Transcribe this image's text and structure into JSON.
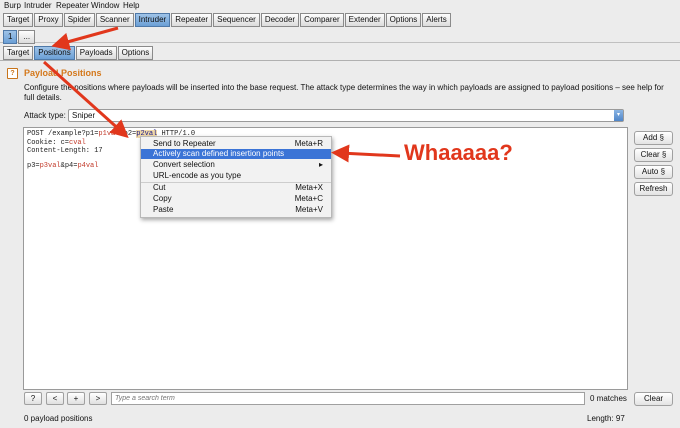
{
  "menubar": [
    "Burp",
    "Intruder",
    "Repeater",
    "Window",
    "Help"
  ],
  "main_tabs": [
    "Target",
    "Proxy",
    "Spider",
    "Scanner",
    "Intruder",
    "Repeater",
    "Sequencer",
    "Decoder",
    "Comparer",
    "Extender",
    "Options",
    "Alerts"
  ],
  "main_tabs_active": "Intruder",
  "number_tabs": [
    "1",
    "..."
  ],
  "sub_tabs": [
    "Target",
    "Positions",
    "Payloads",
    "Options"
  ],
  "sub_tabs_active": "Positions",
  "section": {
    "title": "Payload Positions",
    "description": "Configure the positions where payloads will be inserted into the base request. The attack type determines the way in which payloads are assigned to payload positions – see help for full details.",
    "help_icon": "?"
  },
  "attack_type": {
    "label": "Attack type:",
    "value": "Sniper"
  },
  "request_lines": [
    [
      {
        "t": "POST /example?p1=",
        "c": "plain"
      },
      {
        "t": "p1val",
        "c": "pl"
      },
      {
        "t": "&p2=",
        "c": "plain"
      },
      {
        "t": "p2val",
        "c": "mk"
      },
      {
        "t": " HTTP/1.0",
        "c": "plain"
      }
    ],
    [
      {
        "t": "Cookie: c=",
        "c": "plain"
      },
      {
        "t": "cval",
        "c": "pl"
      }
    ],
    [
      {
        "t": "Content-Length: 17",
        "c": "plain"
      }
    ],
    [],
    [
      {
        "t": "p3=",
        "c": "plain"
      },
      {
        "t": "p3val",
        "c": "pl"
      },
      {
        "t": "&p4=",
        "c": "plain"
      },
      {
        "t": "p4val",
        "c": "pl"
      }
    ]
  ],
  "side_buttons": [
    "Add §",
    "Clear §",
    "Auto §",
    "Refresh"
  ],
  "context_menu": {
    "items": [
      {
        "label": "Send to Repeater",
        "shortcut": "Meta+R"
      },
      {
        "label": "Actively scan defined insertion points",
        "shortcut": "",
        "highlighted": true
      },
      {
        "label": "Convert selection",
        "shortcut": "▸"
      },
      {
        "label": "URL-encode as you type",
        "shortcut": ""
      },
      {
        "label": "Cut",
        "shortcut": "Meta+X"
      },
      {
        "label": "Copy",
        "shortcut": "Meta+C"
      },
      {
        "label": "Paste",
        "shortcut": "Meta+V"
      }
    ]
  },
  "annotation": {
    "text": "Whaaaaa?",
    "color": "#e1371c"
  },
  "search": {
    "buttons": [
      "?",
      "<",
      "+",
      ">"
    ],
    "placeholder": "Type a search term",
    "matches": "0 matches",
    "clear_label": "Clear"
  },
  "status": {
    "payload_positions": "0 payload positions",
    "length": "Length: 97"
  },
  "colors": {
    "accent_title": "#d4781b",
    "tab_active": "#6b9fd6",
    "menu_highlight": "#3b74d6",
    "payload_marker": "#c23a2a"
  }
}
